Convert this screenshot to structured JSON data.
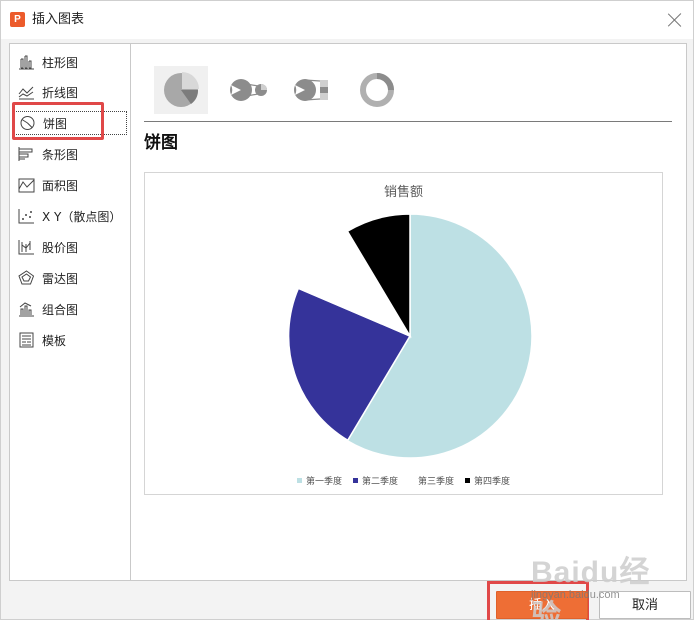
{
  "dialog": {
    "app_icon": "P",
    "title": "插入图表",
    "close_icon": "close-icon"
  },
  "sidebar": {
    "items": [
      {
        "label": "柱形图",
        "icon": "column-chart-icon"
      },
      {
        "label": "折线图",
        "icon": "line-chart-icon"
      },
      {
        "label": "饼图",
        "icon": "pie-chart-icon",
        "selected": true
      },
      {
        "label": "条形图",
        "icon": "bar-chart-icon"
      },
      {
        "label": "面积图",
        "icon": "area-chart-icon"
      },
      {
        "label": "X Y（散点图）",
        "icon": "scatter-chart-icon"
      },
      {
        "label": "股价图",
        "icon": "stock-chart-icon"
      },
      {
        "label": "雷达图",
        "icon": "radar-chart-icon"
      },
      {
        "label": "组合图",
        "icon": "combo-chart-icon"
      },
      {
        "label": "模板",
        "icon": "template-icon"
      }
    ]
  },
  "subtypes": [
    "pie",
    "pie-of-pie",
    "bar-of-pie",
    "doughnut"
  ],
  "section_title": "饼图",
  "chart_data": {
    "type": "pie",
    "title": "销售额",
    "categories": [
      "第一季度",
      "第二季度",
      "第三季度",
      "第四季度"
    ],
    "values": [
      8.2,
      3.2,
      1.4,
      1.2
    ],
    "colors": [
      "#bde0e4",
      "#35339a",
      "#ffffff",
      "#000000"
    ],
    "exploded": true,
    "legend_position": "bottom"
  },
  "footer": {
    "insert_label": "插入",
    "cancel_label": "取消"
  },
  "watermark": {
    "brand": "Baidu经验",
    "sub": "jingyan.baidu.com"
  },
  "colors": {
    "accent": "#ee6e35",
    "highlight": "#e04848"
  }
}
